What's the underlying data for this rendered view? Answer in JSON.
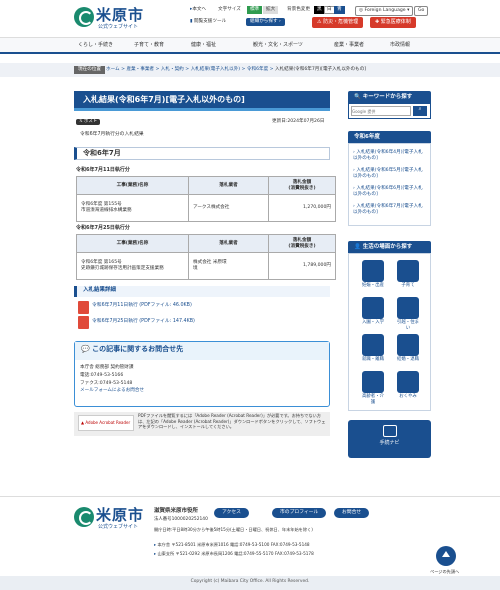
{
  "header": {
    "logo_title": "米原市",
    "logo_sub": "公式ウェブサイト",
    "nav_links": [
      "本文へ",
      "文字サイズ",
      "標準",
      "拡大",
      "背景色変更",
      "黒",
      "白",
      "青"
    ],
    "lang_label": "Foreign Language",
    "go_label": "Go",
    "btn_voice": "閲覧支援ツール",
    "btn_search": "組織から探す",
    "btn_disaster": "防災・危機管理",
    "btn_emergency": "緊急医療体制"
  },
  "nav": [
    "くらし・手続き",
    "子育て・教育",
    "健康・福祉",
    "観光・文化・スポーツ",
    "産業・事業者",
    "市政情報"
  ],
  "breadcrumb": {
    "tag": "現在の位置",
    "items": [
      "ホーム",
      "産業・事業者",
      "入札・契約",
      "入札結果(電子入札以外)",
      "令和6年度",
      "入札結果(令和6年7月)[電子入札以外のもの]"
    ]
  },
  "main": {
    "title": "入札結果(令和6年7月)[電子入札以外のもの]",
    "post_label": "ポスト",
    "updated": "更新日:2024年07月26日",
    "intro": "令和6年7月執行分の入札結果",
    "h2": "令和6年7月",
    "table1": {
      "caption": "令和6年7月11日執行分",
      "headers": [
        "工事(業務)名称",
        "落札業者",
        "落札金額\n(消費税抜き)"
      ],
      "rows": [
        [
          "令和6年度 第155号\n市道湊海道線排水構業務",
          "アークス株式会社",
          "1,270,000円"
        ]
      ]
    },
    "table2": {
      "caption": "令和6年7月25日執行分",
      "headers": [
        "工事(業務)名称",
        "落札業者",
        "落札金額\n(消費税抜き)"
      ],
      "rows": [
        [
          "令和6年度 第165号\n史跡鎌刃城跡保存活用計画策定支援業務",
          "株式会社 米原環\n境",
          "1,789,000円"
        ]
      ]
    },
    "detail_h": "入札結果詳細",
    "pdf1": "令和6年7月11日執行 (PDFファイル: 46.0KB)",
    "pdf2": "令和6年7月25日執行 (PDFファイル: 147.4KB)",
    "contact_h": "この記事に関するお問合せ先",
    "contact_lines": [
      "本庁舎 総務部 契約管財課",
      "電話:0749-53-5166",
      "ファクス:0749-53-5148",
      "メールフォームによるお問合せ"
    ],
    "adobe_text": "PDFファイルを閲覧するには「Adobe Reader (Acrobat Reader)」が必要です。お持ちでない方は、左記の「Adobe Reader (Acrobat Reader)」ダウンロードボタンをクリックして、ソフトウェアをダウンロードし、インストールしてください。",
    "adobe_btn": "Adobe Acrobat Reader"
  },
  "sidebar": {
    "search_h": "キーワードから探す",
    "search_placeholder": "Google 提供",
    "year_h": "令和6年度",
    "year_items": [
      "入札結果(令和6年4月)[電子入札以外のもの]",
      "入札結果(令和6年5月)[電子入札以外のもの]",
      "入札結果(令和6年6月)[電子入札以外のもの]",
      "入札結果(令和6年7月)[電子入札以外のもの]"
    ],
    "life_h": "生活の場面から探す",
    "life_items": [
      "妊娠・出産",
      "子育て",
      "入園・入学",
      "引越・住まい",
      "就職・離職",
      "結婚・退職",
      "高齢者・介護",
      "おくやみ"
    ],
    "navi": "手続ナビ"
  },
  "footer": {
    "logo_title": "米原市",
    "logo_sub": "公式ウェブサイト",
    "office": "滋賀県米原市役所",
    "corp_no": "法人番号1000020252140",
    "hours": "開庁日時:平日8時30分から午後5時15分(土曜日・日曜日、祝休日、年末年始を除く)",
    "btn_access": "アクセス",
    "btn_profile": "市のプロフィール",
    "btn_contact": "お問合せ",
    "addr1": "本庁舎 〒521-8501 米原市米原1016 電話:0749-53-5100 FAX:0749-53-5148",
    "addr2": "山東支所 〒521-0292 米原市長岡1206 電話:0749-55-5170 FAX:0749-53-5178",
    "top_label": "ページの先頭へ",
    "copyright": "Copyright (c) Maibara City Office. All Rights Reserved."
  }
}
